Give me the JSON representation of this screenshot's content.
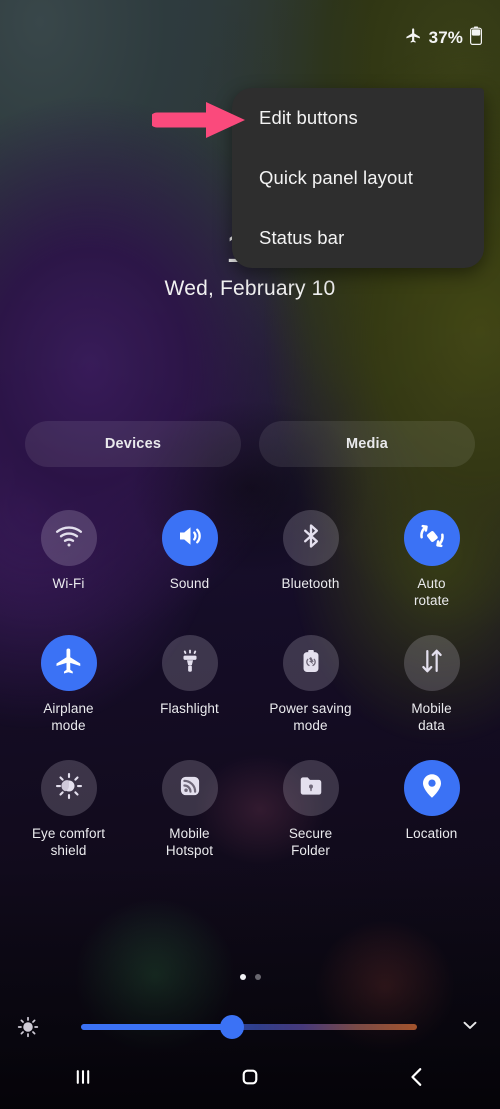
{
  "status_bar": {
    "airplane_icon": "airplane-icon",
    "battery_percent": "37%",
    "battery_icon": "battery-icon"
  },
  "popup_menu": {
    "items": [
      {
        "label": "Edit buttons"
      },
      {
        "label": "Quick panel layout"
      },
      {
        "label": "Status bar"
      }
    ]
  },
  "annotation": {
    "arrow_color": "#fa4a7c",
    "arrow_name": "pink-arrow-pointing-to-edit-buttons"
  },
  "clock": {
    "time": "13",
    "date": "Wed, February 10"
  },
  "pills": [
    {
      "label": "Devices",
      "name": "devices-button"
    },
    {
      "label": "Media",
      "name": "media-button"
    }
  ],
  "toggles": [
    {
      "label": "Wi-Fi",
      "icon": "wifi-icon",
      "on": false
    },
    {
      "label": "Sound",
      "icon": "volume-icon",
      "on": true
    },
    {
      "label": "Bluetooth",
      "icon": "bluetooth-icon",
      "on": false
    },
    {
      "label": "Auto\nrotate",
      "icon": "auto-rotate-icon",
      "on": true
    },
    {
      "label": "Airplane\nmode",
      "icon": "airplane-icon",
      "on": true
    },
    {
      "label": "Flashlight",
      "icon": "flashlight-icon",
      "on": false
    },
    {
      "label": "Power saving\nmode",
      "icon": "power-saving-icon",
      "on": false
    },
    {
      "label": "Mobile\ndata",
      "icon": "mobile-data-icon",
      "on": false
    },
    {
      "label": "Eye comfort\nshield",
      "icon": "eye-comfort-icon",
      "on": false
    },
    {
      "label": "Mobile\nHotspot",
      "icon": "hotspot-icon",
      "on": false
    },
    {
      "label": "Secure\nFolder",
      "icon": "secure-folder-icon",
      "on": false
    },
    {
      "label": "Location",
      "icon": "location-pin-icon",
      "on": true
    }
  ],
  "page_indicator": {
    "count": 2,
    "active": 1
  },
  "brightness": {
    "icon": "brightness-sun-icon",
    "value_percent": 45,
    "expand_icon": "chevron-down-icon"
  },
  "nav_bar": {
    "recents_icon": "recents-icon",
    "home_icon": "home-icon",
    "back_icon": "back-chevron-icon"
  },
  "colors": {
    "accent_blue": "#3b72f5",
    "menu_background": "#2e2e2e",
    "tile_off": "rgba(225,220,235,0.20)"
  }
}
